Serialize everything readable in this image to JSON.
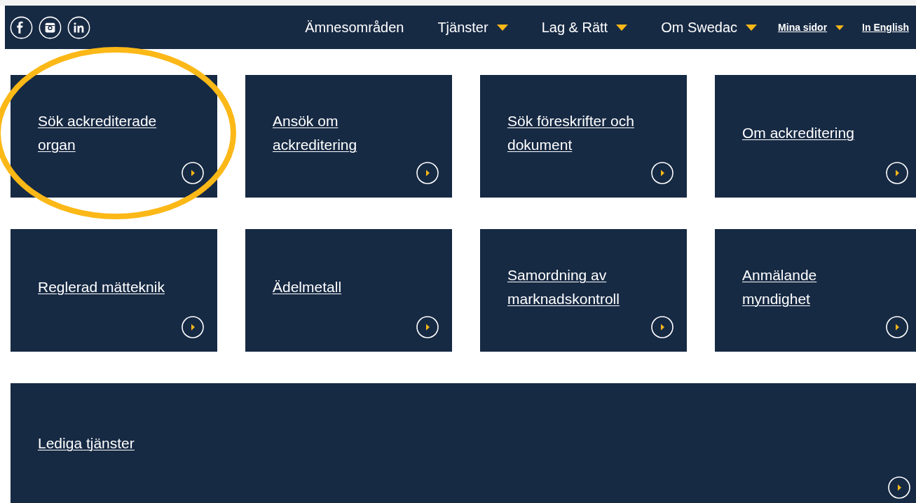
{
  "header": {
    "social": [
      {
        "kind": "facebook"
      },
      {
        "kind": "instagram"
      },
      {
        "kind": "linkedin"
      }
    ],
    "nav": [
      {
        "label": "Ämnesområden",
        "dropdown": false
      },
      {
        "label": "Tjänster",
        "dropdown": true
      },
      {
        "label": "Lag & Rätt",
        "dropdown": true
      },
      {
        "label": "Om Swedac",
        "dropdown": true
      }
    ],
    "utility": [
      {
        "label": "Mina sidor",
        "dropdown": true
      },
      {
        "label": "In English",
        "dropdown": false
      }
    ]
  },
  "tiles": [
    {
      "label": "Sök ackrediterade organ",
      "highlighted": true
    },
    {
      "label": "Ansök om ackreditering",
      "highlighted": false
    },
    {
      "label": "Sök föreskrifter och dokument",
      "highlighted": false
    },
    {
      "label": "Om ackreditering",
      "highlighted": false
    },
    {
      "label": "Reglerad mätteknik",
      "highlighted": false
    },
    {
      "label": "Ädelmetall",
      "highlighted": false
    },
    {
      "label": "Samordning av marknadskontroll",
      "highlighted": false
    },
    {
      "label": "Anmälande myndighet",
      "highlighted": false
    }
  ],
  "wide_tile": {
    "label": "Lediga tjänster"
  }
}
